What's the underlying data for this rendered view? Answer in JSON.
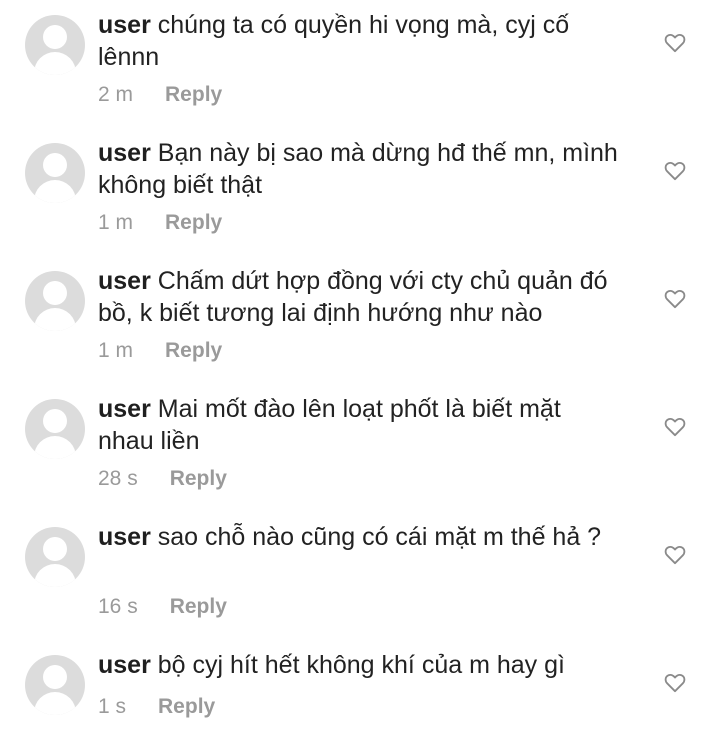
{
  "comments": [
    {
      "username": "user",
      "text": "chúng ta có quyền hi vọng mà, cyj cố lênnn",
      "time": "2 m",
      "reply": "Reply"
    },
    {
      "username": "user",
      "text": "Bạn này bị sao mà dừng hđ thế mn, mình không biết thật",
      "time": "1 m",
      "reply": "Reply"
    },
    {
      "username": "user",
      "text": "Chấm dứt hợp đồng với cty chủ quản đó bồ, k biết tương lai định hướng như nào",
      "time": "1 m",
      "reply": "Reply"
    },
    {
      "username": "user",
      "text": "Mai mốt đào lên loạt phốt là biết mặt nhau liền",
      "time": "28 s",
      "reply": "Reply"
    },
    {
      "username": "user",
      "text": "sao chỗ nào cũng có cái mặt m thế hả ?",
      "time": "16 s",
      "reply": "Reply"
    },
    {
      "username": "user",
      "text": "bộ cyj hít hết không khí của m hay gì",
      "time": "1 s",
      "reply": "Reply"
    }
  ],
  "icons": {
    "avatar": "default-avatar-icon",
    "like": "heart-outline-icon"
  },
  "colors": {
    "avatar_bg": "#dcdcdc",
    "meta_text": "#9a9a9a",
    "body_text": "#222222"
  }
}
